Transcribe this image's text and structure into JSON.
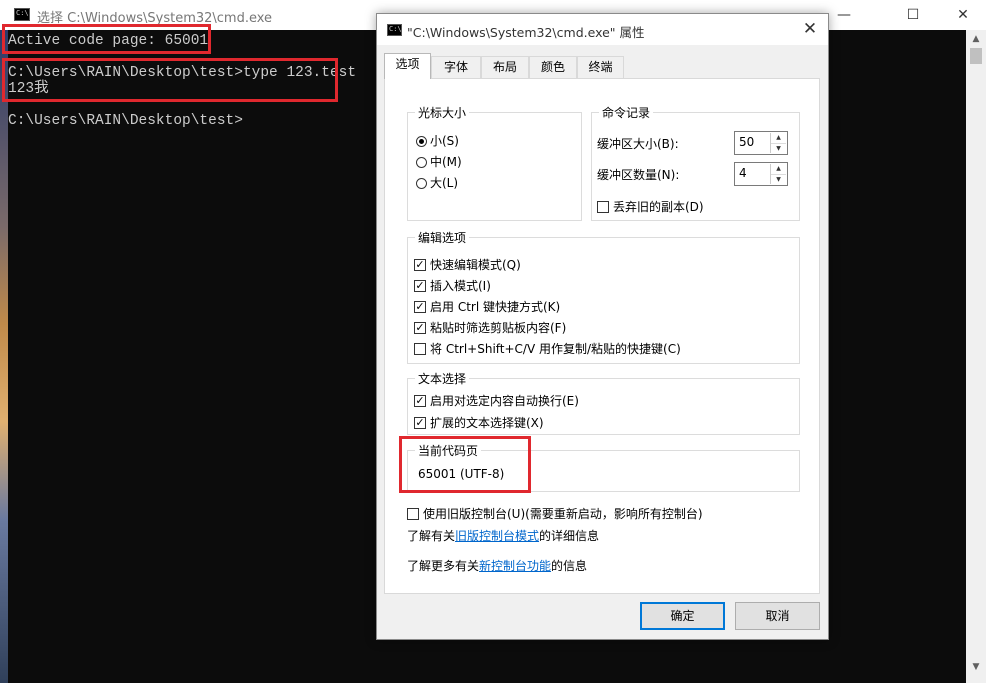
{
  "cmd": {
    "title": "选择 C:\\Windows\\System32\\cmd.exe",
    "icon_text": "C:\\",
    "lines": [
      "Active code page: 65001",
      "C:\\Users\\RAIN\\Desktop\\test>type 123.test",
      "123我",
      "C:\\Users\\RAIN\\Desktop\\test>"
    ],
    "minimize_icon": "—",
    "maximize_icon": "☐",
    "close_icon": "✕"
  },
  "dialog": {
    "title": "\"C:\\Windows\\System32\\cmd.exe\" 属性",
    "close_icon": "✕",
    "tabs": [
      "选项",
      "字体",
      "布局",
      "颜色",
      "终端"
    ],
    "cursor_size": {
      "label": "光标大小",
      "options": [
        "小(S)",
        "中(M)",
        "大(L)"
      ],
      "selected": "小(S)"
    },
    "command_history": {
      "label": "命令记录",
      "buffer_size_label": "缓冲区大小(B):",
      "buffer_size_value": "50",
      "buffer_count_label": "缓冲区数量(N):",
      "buffer_count_value": "4",
      "discard_label": "丢弃旧的副本(D)"
    },
    "edit_options": {
      "label": "编辑选项",
      "items": [
        {
          "label": "快速编辑模式(Q)",
          "checked": true
        },
        {
          "label": "插入模式(I)",
          "checked": true
        },
        {
          "label": "启用 Ctrl 键快捷方式(K)",
          "checked": true
        },
        {
          "label": "粘贴时筛选剪贴板内容(F)",
          "checked": true
        },
        {
          "label": "将 Ctrl+Shift+C/V 用作复制/粘贴的快捷键(C)",
          "checked": false
        }
      ]
    },
    "text_selection": {
      "label": "文本选择",
      "items": [
        {
          "label": "启用对选定内容自动换行(E)",
          "checked": true
        },
        {
          "label": "扩展的文本选择键(X)",
          "checked": true
        }
      ]
    },
    "code_page": {
      "label": "当前代码页",
      "value": "65001 (UTF-8)"
    },
    "legacy": {
      "label": "使用旧版控制台(U)(需要重新启动，影响所有控制台)",
      "learn1_prefix": "了解有关",
      "learn1_link": "旧版控制台模式",
      "learn1_suffix": "的详细信息",
      "learn2_prefix": "了解更多有关",
      "learn2_link": "新控制台功能",
      "learn2_suffix": "的信息"
    },
    "ok_label": "确定",
    "cancel_label": "取消"
  },
  "colors": {
    "highlight": "#e0282e",
    "link": "#0066cc",
    "console_bg": "#0c0c0c",
    "console_fg": "#cccccc"
  }
}
